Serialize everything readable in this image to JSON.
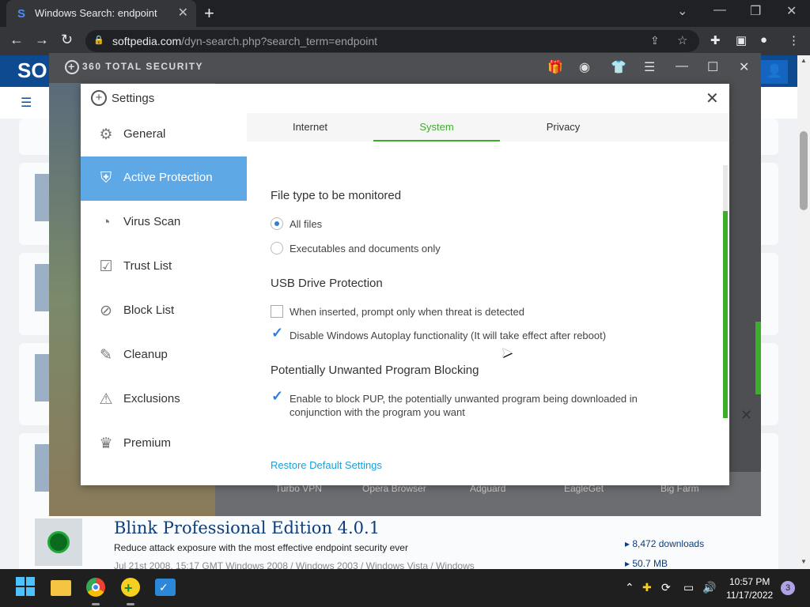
{
  "browser": {
    "tab_title": "Windows Search: endpoint",
    "tab_favicon": "S",
    "url_domain": "softpedia.com",
    "url_path": "/dyn-search.php?search_term=endpoint"
  },
  "app": {
    "brand": "360 TOTAL SECURITY",
    "bottom_items": [
      "Turbo VPN",
      "Opera Browser",
      "Adguard",
      "EagleGet",
      "Big Farm"
    ]
  },
  "settings": {
    "title": "Settings",
    "sidebar": [
      {
        "label": "General",
        "icon": "gear-icon",
        "glyph": "⚙"
      },
      {
        "label": "Active Protection",
        "icon": "shield-icon",
        "glyph": "⛨"
      },
      {
        "label": "Virus Scan",
        "icon": "scan-icon",
        "glyph": "◔"
      },
      {
        "label": "Trust List",
        "icon": "trust-list-icon",
        "glyph": "☑"
      },
      {
        "label": "Block List",
        "icon": "block-list-icon",
        "glyph": "⊘"
      },
      {
        "label": "Cleanup",
        "icon": "broom-icon",
        "glyph": "✎"
      },
      {
        "label": "Exclusions",
        "icon": "exclusions-icon",
        "glyph": "⚠"
      },
      {
        "label": "Premium",
        "icon": "crown-icon",
        "glyph": "♛"
      }
    ],
    "active_sidebar": "Active Protection",
    "tabs": [
      "Internet",
      "System",
      "Privacy"
    ],
    "active_tab": "System",
    "file_type_heading": "File type to be monitored",
    "file_type_options": [
      "All files",
      "Executables and documents only"
    ],
    "file_type_selected": "All files",
    "usb_heading": "USB Drive Protection",
    "usb_options": [
      {
        "label": "When inserted, prompt only when threat is detected",
        "checked": false
      },
      {
        "label": "Disable Windows Autoplay functionality (It will take effect after reboot)",
        "checked": true
      }
    ],
    "pup_heading": "Potentially Unwanted Program Blocking",
    "pup_option": {
      "label": "Enable to block PUP, the potentially unwanted program being downloaded in conjunction with the program you want",
      "checked": true
    },
    "restore_label": "Restore Default Settings"
  },
  "listing": {
    "title": "Blink Professional Edition 4.0.1",
    "description": "Reduce attack exposure with the most effective endpoint security ever",
    "meta": "Jul 21st 2008, 15:17 GMT        Windows 2008 / Windows 2003 / Windows Vista / Windows",
    "downloads": "8,472 downloads",
    "size": "50.7 MB"
  },
  "taskbar": {
    "time": "10:57 PM",
    "date": "11/17/2022",
    "notification_count": "3"
  }
}
